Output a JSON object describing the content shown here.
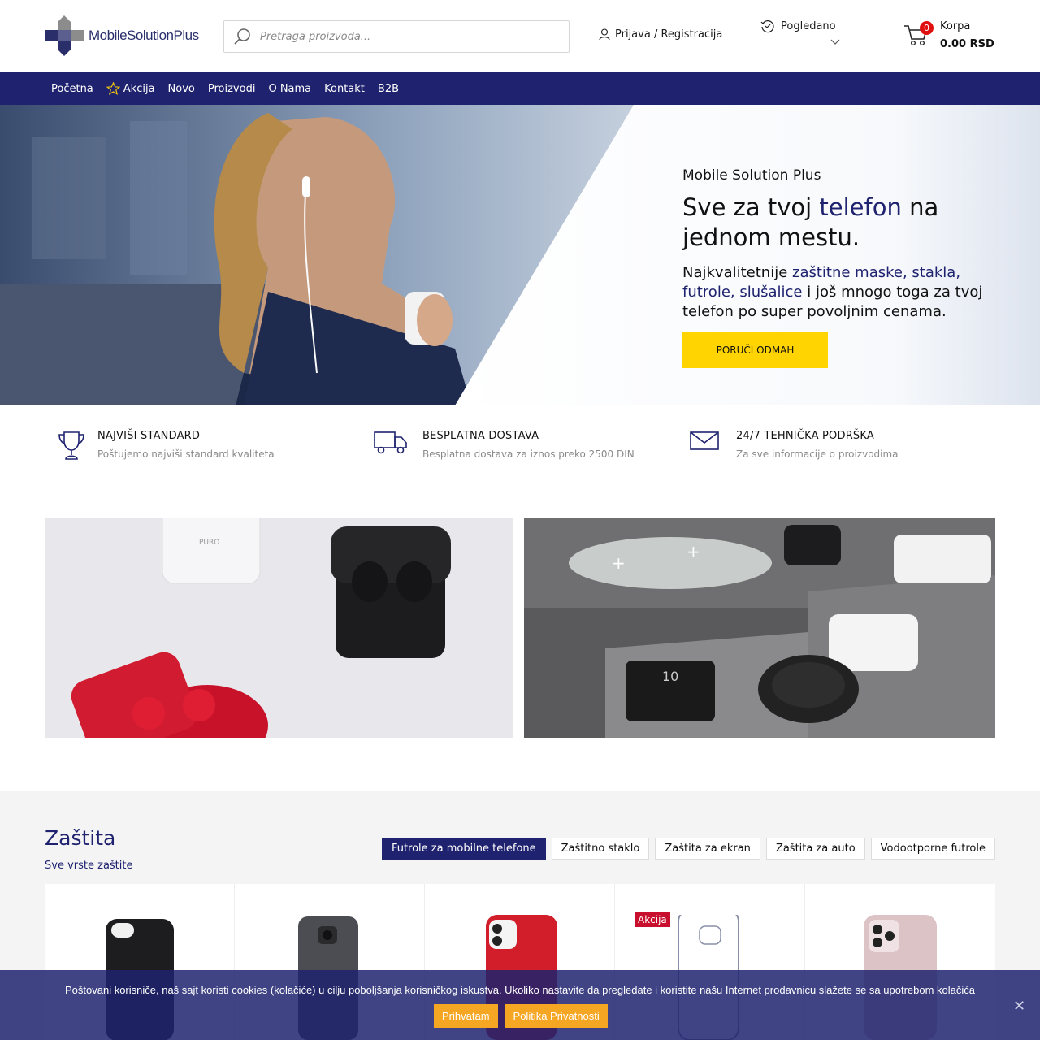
{
  "header": {
    "logo_text": "MobileSolutionPlus",
    "search_placeholder": "Pretraga proizvoda...",
    "login_label": "Prijava / Registracija",
    "viewed_label": "Pogledano",
    "cart": {
      "label": "Korpa",
      "total": "0.00 RSD",
      "count": "0"
    }
  },
  "nav": {
    "items": [
      "Početna",
      "Akcija",
      "Novo",
      "Proizvodi",
      "O Nama",
      "Kontakt",
      "B2B"
    ]
  },
  "hero": {
    "brand": "Mobile Solution Plus",
    "title_pre": "Sve za tvoj ",
    "title_hl": "telefon",
    "title_post": " na jednom mestu.",
    "desc_pre": "Najkvalitetnije ",
    "desc_hl": "zaštitne maske, stakla, futrole, slušalice",
    "desc_post": " i još mnogo toga za tvoj telefon po super povoljnim cenama.",
    "cta": "PORUČI ODMAH"
  },
  "features": [
    {
      "title": "NAJVIŠI STANDARD",
      "subtitle": "Poštujemo najviši standard kvaliteta",
      "icon": "trophy-icon"
    },
    {
      "title": "BESPLATNA DOSTAVA",
      "subtitle": "Besplatna dostava za iznos preko 2500 DIN",
      "icon": "truck-icon"
    },
    {
      "title": "24/7 TEHNIČKA PODRŠKA",
      "subtitle": "Za sve informacije o proizvodima",
      "icon": "envelope-icon"
    }
  ],
  "banners": {
    "left_text": "PURO",
    "right_text": "10"
  },
  "section": {
    "title": "Zaštita",
    "subtitle": "Sve vrste zaštite",
    "tabs": [
      "Futrole za mobilne telefone",
      "Zaštitno staklo",
      "Zaštita za ekran",
      "Zaštita za auto",
      "Vodootporne futrole"
    ],
    "sale_badge": "Akcija"
  },
  "cookie": {
    "message": "Poštovani korisniče, naš sajt koristi cookies (kolačiće) u cilju poboljšanja korisničkog iskustva. Ukoliko nastavite da pregledate i koristite našu Internet prodavnicu slažete se sa upotrebom kolačića",
    "accept": "Prihvatam",
    "policy": "Politika Privatnosti",
    "close": "✕"
  },
  "colors": {
    "brand": "#1f236f",
    "accent": "#ffd400",
    "badge": "#e11010",
    "cookie_button": "#f5a623"
  }
}
